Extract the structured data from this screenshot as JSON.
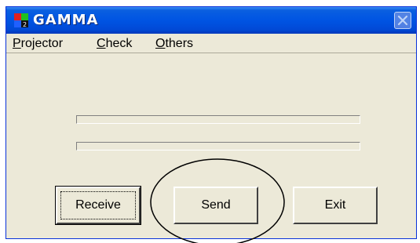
{
  "window": {
    "title": "GAMMA",
    "icon": "app-icon",
    "close_icon": "close-icon"
  },
  "menu": [
    {
      "mnemonic": "P",
      "rest": "rojector"
    },
    {
      "mnemonic": "C",
      "rest": "heck"
    },
    {
      "mnemonic": "O",
      "rest": "thers"
    }
  ],
  "buttons": {
    "receive_label": "Receive",
    "send_label": "Send",
    "exit_label": "Exit"
  },
  "progress": [
    0,
    0
  ],
  "colors": {
    "titlebar": "#0054e3",
    "face": "#ece9d8"
  }
}
